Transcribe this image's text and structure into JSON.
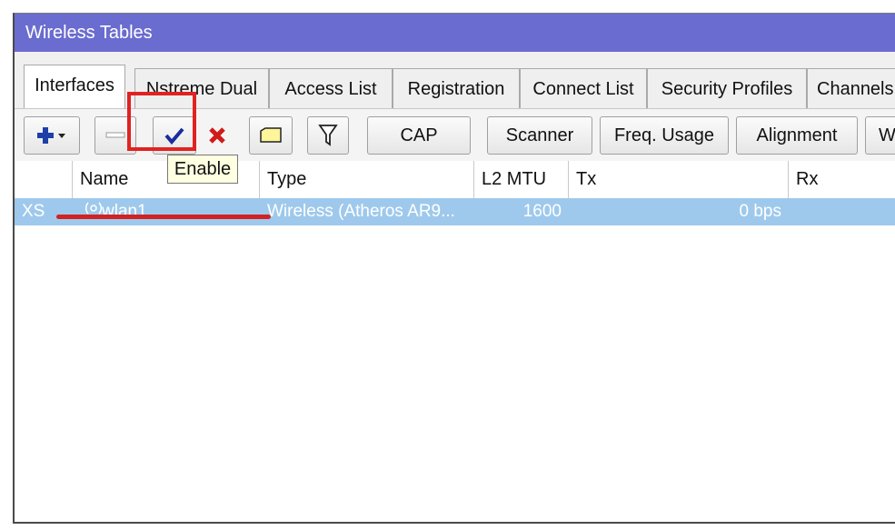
{
  "window": {
    "title": "Wireless Tables"
  },
  "tabs": [
    {
      "label": "Interfaces",
      "active": true
    },
    {
      "label": "Nstreme Dual"
    },
    {
      "label": "Access List"
    },
    {
      "label": "Registration"
    },
    {
      "label": "Connect List"
    },
    {
      "label": "Security Profiles"
    },
    {
      "label": "Channels"
    }
  ],
  "toolbar": {
    "add_icon": "plus-dropdown-icon",
    "remove_icon": "minus-icon",
    "enable_icon": "checkmark-icon",
    "disable_icon": "x-icon",
    "comment_icon": "comment-icon",
    "filter_icon": "filter-icon",
    "cap_label": "CAP",
    "scanner_label": "Scanner",
    "freq_usage_label": "Freq. Usage",
    "alignment_label": "Alignment",
    "w_label": "W"
  },
  "table": {
    "columns": [
      "Name",
      "Type",
      "L2 MTU",
      "Tx",
      "Rx"
    ],
    "rows": [
      {
        "flags": "XS",
        "name": "wlan1",
        "type": "Wireless (Atheros AR9...",
        "l2mtu": "1600",
        "tx": "0 bps",
        "rx": ""
      }
    ]
  },
  "tooltip": {
    "text": "Enable"
  },
  "colors": {
    "titlebar": "#6b6ccf",
    "selected_row": "#9ec9ec",
    "highlight": "#e02222"
  }
}
